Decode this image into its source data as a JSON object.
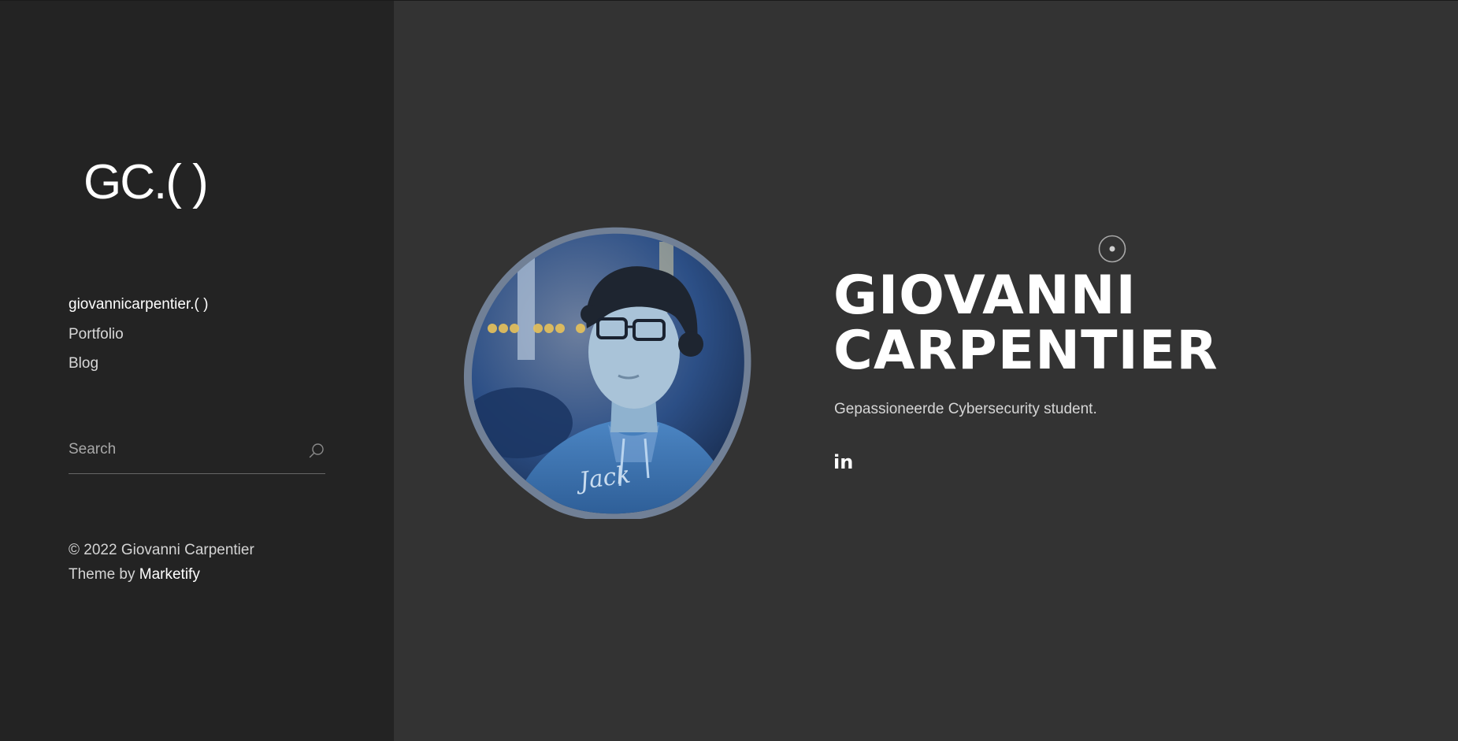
{
  "sidebar": {
    "logo": "GC.( )",
    "nav": [
      {
        "label": "giovannicarpentier.( )"
      },
      {
        "label": "Portfolio"
      },
      {
        "label": "Blog"
      }
    ],
    "search": {
      "placeholder": "Search"
    },
    "footer": {
      "copyright": "© 2022 Giovanni Carpentier",
      "theme_prefix": "Theme by ",
      "theme_brand": "Marketify"
    }
  },
  "hero": {
    "name_line1": "GIOVANNI",
    "name_line2": "CARPENTIER",
    "tagline": "Gepassioneerde Cybersecurity student.",
    "social": [
      {
        "icon": "linkedin-icon",
        "label": "in"
      }
    ]
  },
  "colors": {
    "sidebar_bg": "#232323",
    "main_bg": "#333333",
    "text": "#ffffff"
  }
}
